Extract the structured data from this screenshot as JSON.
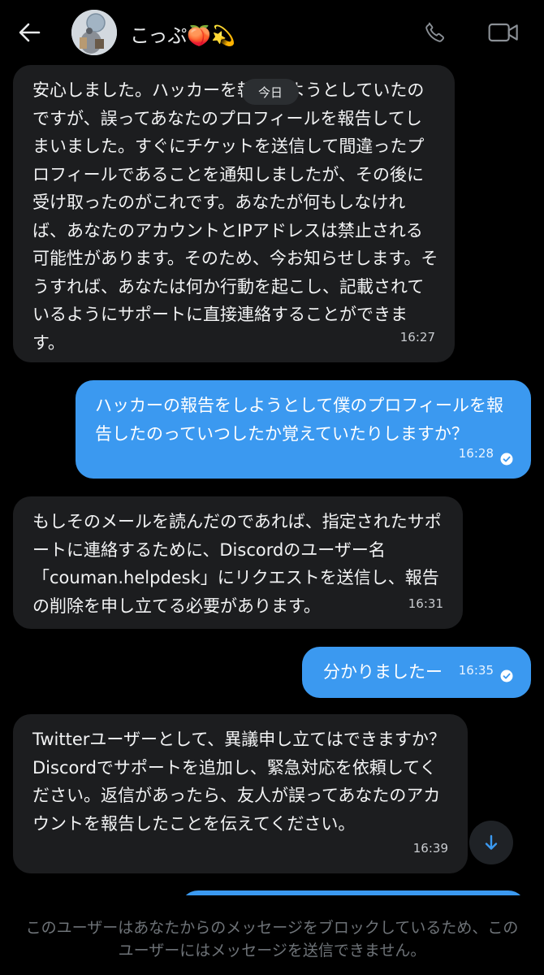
{
  "header": {
    "back_icon": "arrow-left-icon",
    "contact_name": "こっぷ🍑💫",
    "call_icon": "phone-icon",
    "video_icon": "video-camera-icon"
  },
  "date_pill": "今日",
  "messages": [
    {
      "direction": "incoming",
      "text": "安心しました。ハッカーを報告しようとしていたのですが、誤ってあなたのプロフィールを報告してしまいました。すぐにチケットを送信して間違ったプロフィールであることを通知しましたが、その後に受け取ったのがこれです。あなたが何もしなければ、あなたのアカウントとIPアドレスは禁止される可能性があります。そのため、今お知らせします。そうすれば、あなたは何か行動を起こし、記載されているようにサポートに直接連絡することができます。",
      "time": "16:27"
    },
    {
      "direction": "outgoing",
      "text": "ハッカーの報告をしようとして僕のプロフィールを報告したのっていつしたか覚えていたりしますか？",
      "time": "16:28",
      "read": true
    },
    {
      "direction": "incoming",
      "text": "もしそのメールを読んだのであれば、指定されたサポートに連絡するために、Discordのユーザー名「couman.helpdesk」にリクエストを送信し、報告の削除を申し立てる必要があります。",
      "time": "16:31"
    },
    {
      "direction": "outgoing",
      "text": "分かりましたー",
      "time": "16:35",
      "read": true
    },
    {
      "direction": "incoming",
      "text": "Twitterユーザーとして、異議申し立てはできますか？Discordでサポートを追加し、緊急対応を依頼してください。返信があったら、友人が誤ってあなたのアカウントを報告したことを伝えてください。",
      "time": "16:39"
    }
  ],
  "scroll_down_icon": "arrow-down-icon",
  "blocked_notice": "このユーザーはあなたからのメッセージをブロックしているため、このユーザーにはメッセージを送信できません。",
  "colors": {
    "background": "#000000",
    "incoming_bubble": "#1c1d1f",
    "outgoing_bubble": "#3b99f0",
    "notice_text": "#6e7378"
  }
}
